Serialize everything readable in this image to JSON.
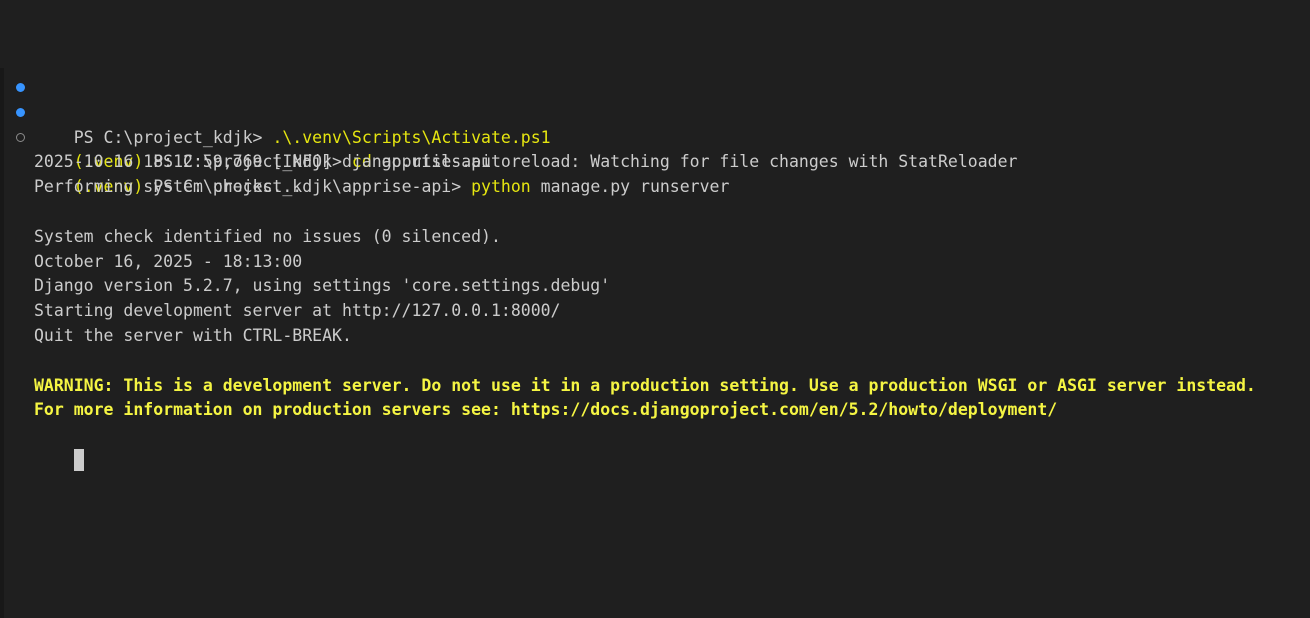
{
  "terminal": {
    "commands": [
      {
        "env": "",
        "prompt": "PS C:\\project_kdjk> ",
        "exe": ".\\.venv\\Scripts\\Activate.ps1",
        "args": "",
        "decoration": "success"
      },
      {
        "env": "(.venv)",
        "prompt": " PS C:\\project_kdjk> ",
        "exe": "cd",
        "args": " apprise-api",
        "decoration": "success"
      },
      {
        "env": "(.venv)",
        "prompt": " PS C:\\project_kdjk\\apprise-api> ",
        "exe": "python",
        "args": " manage.py runserver",
        "decoration": "pending"
      }
    ],
    "output": [
      "2025-10-16 18:12:59,769 [INFO] django.utils.autoreload: Watching for file changes with StatReloader",
      "Performing system checks...",
      "",
      "System check identified no issues (0 silenced).",
      "October 16, 2025 - 18:13:00",
      "Django version 5.2.7, using settings 'core.settings.debug'",
      "Starting development server at http://127.0.0.1:8000/",
      "Quit the server with CTRL-BREAK.",
      ""
    ],
    "warnings": [
      "WARNING: This is a development server. Do not use it in a production setting. Use a production WSGI or ASGI server instead.",
      "For more information on production servers see: https://docs.djangoproject.com/en/5.2/howto/deployment/"
    ]
  },
  "colors": {
    "background": "#1f1f1f",
    "foreground": "#cccccc",
    "yellow": "#e5e510",
    "bright_yellow": "#f5f543",
    "decoration_success": "#3794ff"
  }
}
